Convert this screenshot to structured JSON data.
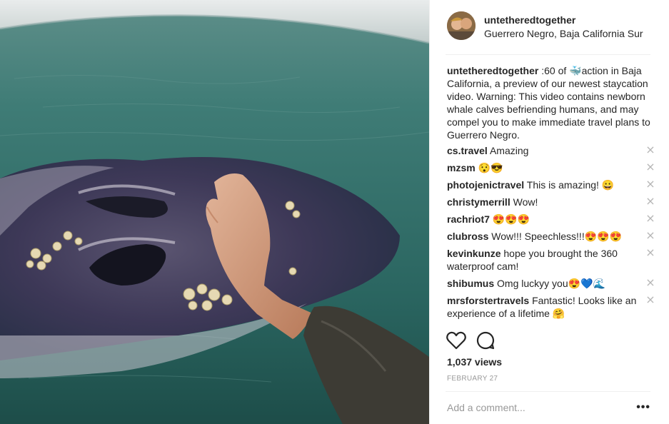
{
  "post": {
    "author": "untetheredtogether",
    "location": "Guerrero Negro, Baja California Sur",
    "caption": ":60 of 🐳action in Baja California, a preview of our newest staycation video. Warning: This video contains newborn whale calves befriending humans, and may compel you to make immediate travel plans to Guerrero Negro.",
    "views": "1,037 views",
    "date": "FEBRUARY 27",
    "add_comment_placeholder": "Add a comment...",
    "more_label": "•••"
  },
  "comments": [
    {
      "user": "cs.travel",
      "text": "Amazing"
    },
    {
      "user": "mzsm",
      "text": "😯😎"
    },
    {
      "user": "photojenictravel",
      "text": "This is amazing! 😀"
    },
    {
      "user": "christymerrill",
      "text": "Wow!"
    },
    {
      "user": "rachriot7",
      "text": "😍😍😍"
    },
    {
      "user": "clubross",
      "text": "Wow!!! Speechless!!!😍😍😍"
    },
    {
      "user": "kevinkunze",
      "text": "hope you brought the 360 waterproof cam!"
    },
    {
      "user": "shibumus",
      "text": "Omg luckyy you😍💙🌊"
    },
    {
      "user": "mrsforstertravels",
      "text": "Fantastic! Looks like an experience of a lifetime 🤗"
    }
  ],
  "icons": {
    "like": "heart-icon",
    "comment": "comment-bubble-icon",
    "close": "close-icon"
  }
}
